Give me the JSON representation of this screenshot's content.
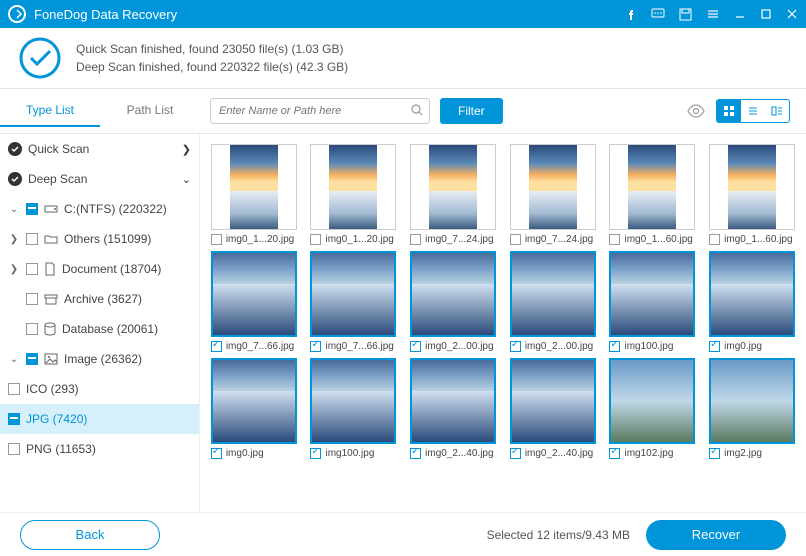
{
  "app": {
    "title": "FoneDog Data Recovery"
  },
  "status": {
    "line1": "Quick Scan finished, found 23050 file(s) (1.03 GB)",
    "line2": "Deep Scan finished, found 220322 file(s) (42.3 GB)"
  },
  "tabs": {
    "type": "Type List",
    "path": "Path List"
  },
  "search": {
    "placeholder": "Enter Name or Path here"
  },
  "filter": {
    "label": "Filter"
  },
  "sidebar": {
    "quick": "Quick Scan",
    "deep": "Deep Scan",
    "drive": "C:(NTFS) (220322)",
    "others": "Others (151099)",
    "document": "Document (18704)",
    "archive": "Archive (3627)",
    "database": "Database (20061)",
    "image": "Image (26362)",
    "ico": "ICO (293)",
    "jpg": "JPG (7420)",
    "png": "PNG (11653)"
  },
  "files": [
    {
      "name": "img0_1...20.jpg",
      "checked": false,
      "shape": "portrait",
      "active": false
    },
    {
      "name": "img0_1...20.jpg",
      "checked": false,
      "shape": "portrait",
      "active": false
    },
    {
      "name": "img0_7...24.jpg",
      "checked": false,
      "shape": "portrait",
      "active": false
    },
    {
      "name": "img0_7...24.jpg",
      "checked": false,
      "shape": "portrait",
      "active": false
    },
    {
      "name": "img0_1...60.jpg",
      "checked": false,
      "shape": "portrait",
      "active": false
    },
    {
      "name": "img0_1...60.jpg",
      "checked": false,
      "shape": "portrait",
      "active": false
    },
    {
      "name": "img0_7...66.jpg",
      "checked": true,
      "shape": "wide",
      "active": true
    },
    {
      "name": "img0_7...66.jpg",
      "checked": true,
      "shape": "wide",
      "active": true
    },
    {
      "name": "img0_2...00.jpg",
      "checked": true,
      "shape": "wide",
      "active": true
    },
    {
      "name": "img0_2...00.jpg",
      "checked": true,
      "shape": "wide",
      "active": true
    },
    {
      "name": "img100.jpg",
      "checked": true,
      "shape": "wide",
      "active": true
    },
    {
      "name": "img0.jpg",
      "checked": true,
      "shape": "wide",
      "active": true
    },
    {
      "name": "img0.jpg",
      "checked": true,
      "shape": "wide",
      "active": true
    },
    {
      "name": "img100.jpg",
      "checked": true,
      "shape": "wide",
      "active": true
    },
    {
      "name": "img0_2...40.jpg",
      "checked": true,
      "shape": "wide",
      "active": true
    },
    {
      "name": "img0_2...40.jpg",
      "checked": true,
      "shape": "wide",
      "active": true
    },
    {
      "name": "img102.jpg",
      "checked": true,
      "shape": "pano",
      "active": true
    },
    {
      "name": "img2.jpg",
      "checked": true,
      "shape": "pano",
      "active": true
    }
  ],
  "footer": {
    "back": "Back",
    "selected": "Selected 12 items/9.43 MB",
    "recover": "Recover"
  }
}
